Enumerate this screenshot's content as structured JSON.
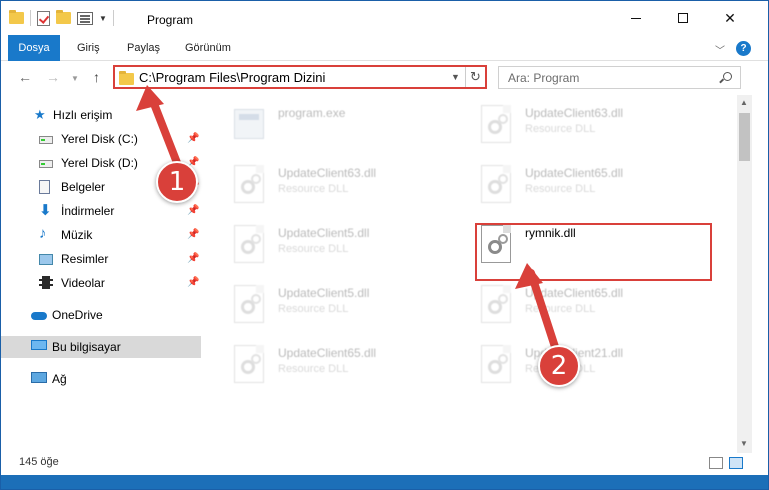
{
  "window": {
    "title": "Program"
  },
  "qat": {
    "icons": [
      "folder-icon",
      "properties-checklist-icon",
      "new-folder-icon",
      "view-icon"
    ]
  },
  "ribbon": {
    "tabs": [
      {
        "label": "Dosya",
        "active": true
      },
      {
        "label": "Giriş"
      },
      {
        "label": "Paylaş"
      },
      {
        "label": "Görünüm"
      }
    ],
    "help": "?"
  },
  "navigation": {
    "address": "C:\\Program Files\\Program Dizini",
    "search_placeholder": "Ara: Program"
  },
  "sidebar": {
    "items": [
      {
        "label": "Hızlı erişim"
      },
      {
        "label": "Yerel Disk (C:)"
      },
      {
        "label": "Yerel Disk (D:)"
      },
      {
        "label": "Belgeler"
      },
      {
        "label": "İndirmeler"
      },
      {
        "label": "Müzik"
      },
      {
        "label": "Resimler"
      },
      {
        "label": "Videolar"
      },
      {
        "label": "OneDrive"
      },
      {
        "label": "Bu bilgisayar",
        "selected": true
      },
      {
        "label": "Ağ"
      }
    ]
  },
  "files": [
    {
      "name": "program.exe",
      "type": ""
    },
    {
      "name": "UpdateClient63.dll",
      "type": "Resource DLL"
    },
    {
      "name": "UpdateClient63.dll",
      "type": "Resource DLL"
    },
    {
      "name": "UpdateClient65.dll",
      "type": "Resource DLL"
    },
    {
      "name": "UpdateClient5.dll",
      "type": "Resource DLL"
    },
    {
      "name": "rymnik.dll",
      "type": ""
    },
    {
      "name": "UpdateClient5.dll",
      "type": "Resource DLL"
    },
    {
      "name": "UpdateClient65.dll",
      "type": "Resource DLL"
    },
    {
      "name": "UpdateClient65.dll",
      "type": "Resource DLL"
    },
    {
      "name": "UpdateClient21.dll",
      "type": "Resource DLL"
    }
  ],
  "status": {
    "item_count": "145 öğe"
  },
  "annotations": {
    "step1": "1",
    "step2": "2",
    "color": "#d9403a"
  }
}
